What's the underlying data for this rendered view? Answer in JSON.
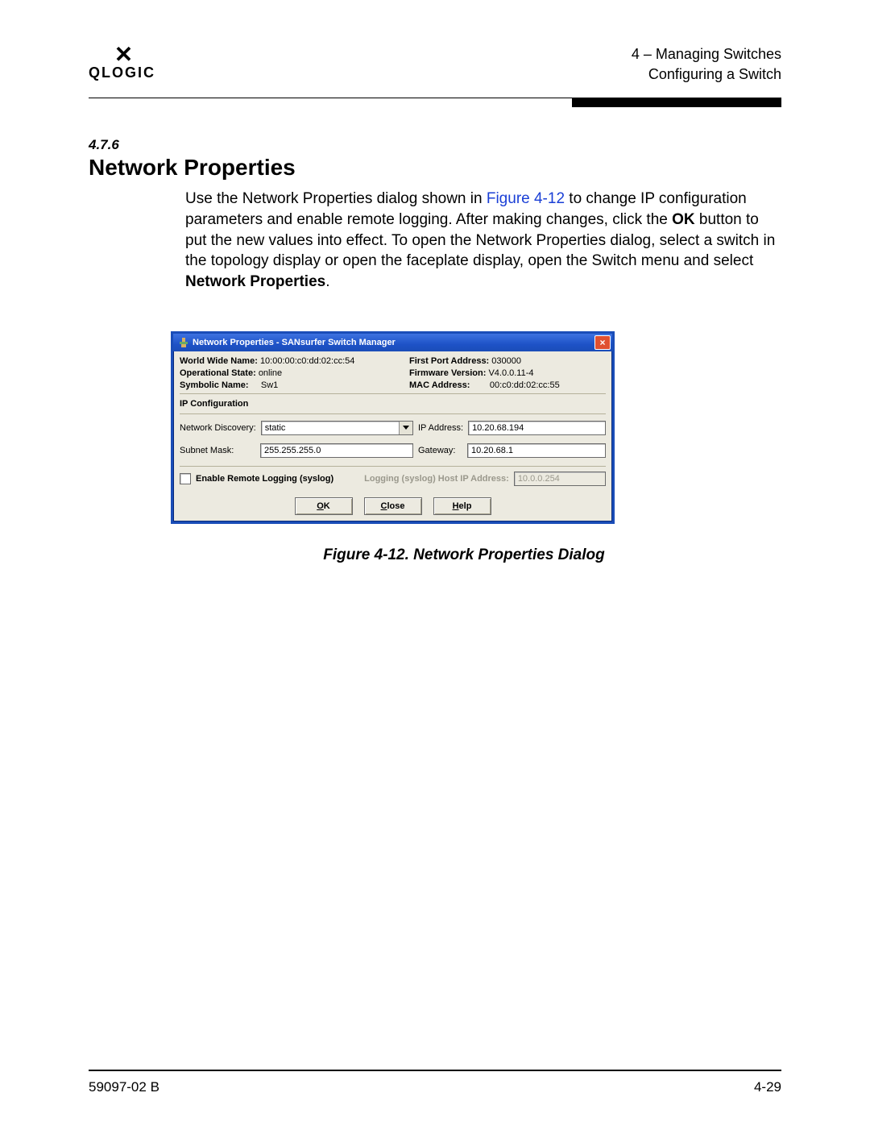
{
  "header": {
    "logo_text": "QLOGIC",
    "chapter_line1": "4 – Managing Switches",
    "chapter_line2": "Configuring a Switch"
  },
  "section": {
    "number": "4.7.6",
    "title": "Network Properties",
    "para_1": "Use the Network Properties dialog shown in ",
    "figure_ref": "Figure 4-12",
    "para_2": " to change IP configuration parameters and enable remote logging. After making changes, click the ",
    "ok_bold": "OK",
    "para_3": " button to put the new values into effect. To open the Network Properties dialog, select a switch in the topology display or open the faceplate display, open the Switch menu and select ",
    "np_bold": "Network Properties",
    "para_4": "."
  },
  "dialog": {
    "title": "Network Properties - SANsurfer Switch Manager",
    "info": {
      "wwn_label": "World Wide Name:",
      "wwn_value": "10:00:00:c0:dd:02:cc:54",
      "opstate_label": "Operational State:",
      "opstate_value": "online",
      "symname_label": "Symbolic Name:",
      "symname_value": "Sw1",
      "fpa_label": "First Port Address:",
      "fpa_value": "030000",
      "fw_label": "Firmware Version:",
      "fw_value": "V4.0.0.11-4",
      "mac_label": "MAC Address:",
      "mac_value": "00:c0:dd:02:cc:55"
    },
    "ipconfig": {
      "section_label": "IP Configuration",
      "discovery_label": "Network Discovery:",
      "discovery_value": "static",
      "ip_label": "IP Address:",
      "ip_value": "10.20.68.194",
      "subnet_label": "Subnet Mask:",
      "subnet_value": "255.255.255.0",
      "gw_label": "Gateway:",
      "gw_value": "10.20.68.1"
    },
    "logging": {
      "chk_label": "Enable Remote Logging (syslog)",
      "host_label": "Logging (syslog) Host IP Address:",
      "host_value": "10.0.0.254"
    },
    "buttons": {
      "ok_pre": "O",
      "ok_rest": "K",
      "close_pre": "C",
      "close_rest": "lose",
      "help_pre": "H",
      "help_rest": "elp"
    }
  },
  "caption": "Figure 4-12.  Network Properties Dialog",
  "footer": {
    "left": "59097-02 B",
    "right": "4-29"
  }
}
